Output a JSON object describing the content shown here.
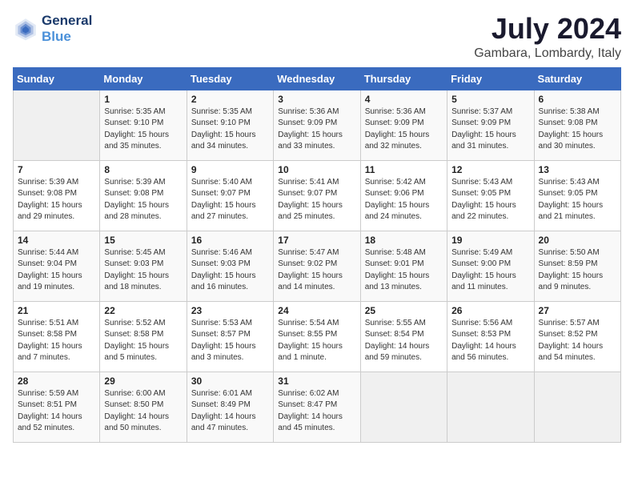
{
  "header": {
    "logo_line1": "General",
    "logo_line2": "Blue",
    "month": "July 2024",
    "location": "Gambara, Lombardy, Italy"
  },
  "weekdays": [
    "Sunday",
    "Monday",
    "Tuesday",
    "Wednesday",
    "Thursday",
    "Friday",
    "Saturday"
  ],
  "weeks": [
    [
      {
        "num": "",
        "info": ""
      },
      {
        "num": "1",
        "info": "Sunrise: 5:35 AM\nSunset: 9:10 PM\nDaylight: 15 hours\nand 35 minutes."
      },
      {
        "num": "2",
        "info": "Sunrise: 5:35 AM\nSunset: 9:10 PM\nDaylight: 15 hours\nand 34 minutes."
      },
      {
        "num": "3",
        "info": "Sunrise: 5:36 AM\nSunset: 9:09 PM\nDaylight: 15 hours\nand 33 minutes."
      },
      {
        "num": "4",
        "info": "Sunrise: 5:36 AM\nSunset: 9:09 PM\nDaylight: 15 hours\nand 32 minutes."
      },
      {
        "num": "5",
        "info": "Sunrise: 5:37 AM\nSunset: 9:09 PM\nDaylight: 15 hours\nand 31 minutes."
      },
      {
        "num": "6",
        "info": "Sunrise: 5:38 AM\nSunset: 9:08 PM\nDaylight: 15 hours\nand 30 minutes."
      }
    ],
    [
      {
        "num": "7",
        "info": "Sunrise: 5:39 AM\nSunset: 9:08 PM\nDaylight: 15 hours\nand 29 minutes."
      },
      {
        "num": "8",
        "info": "Sunrise: 5:39 AM\nSunset: 9:08 PM\nDaylight: 15 hours\nand 28 minutes."
      },
      {
        "num": "9",
        "info": "Sunrise: 5:40 AM\nSunset: 9:07 PM\nDaylight: 15 hours\nand 27 minutes."
      },
      {
        "num": "10",
        "info": "Sunrise: 5:41 AM\nSunset: 9:07 PM\nDaylight: 15 hours\nand 25 minutes."
      },
      {
        "num": "11",
        "info": "Sunrise: 5:42 AM\nSunset: 9:06 PM\nDaylight: 15 hours\nand 24 minutes."
      },
      {
        "num": "12",
        "info": "Sunrise: 5:43 AM\nSunset: 9:05 PM\nDaylight: 15 hours\nand 22 minutes."
      },
      {
        "num": "13",
        "info": "Sunrise: 5:43 AM\nSunset: 9:05 PM\nDaylight: 15 hours\nand 21 minutes."
      }
    ],
    [
      {
        "num": "14",
        "info": "Sunrise: 5:44 AM\nSunset: 9:04 PM\nDaylight: 15 hours\nand 19 minutes."
      },
      {
        "num": "15",
        "info": "Sunrise: 5:45 AM\nSunset: 9:03 PM\nDaylight: 15 hours\nand 18 minutes."
      },
      {
        "num": "16",
        "info": "Sunrise: 5:46 AM\nSunset: 9:03 PM\nDaylight: 15 hours\nand 16 minutes."
      },
      {
        "num": "17",
        "info": "Sunrise: 5:47 AM\nSunset: 9:02 PM\nDaylight: 15 hours\nand 14 minutes."
      },
      {
        "num": "18",
        "info": "Sunrise: 5:48 AM\nSunset: 9:01 PM\nDaylight: 15 hours\nand 13 minutes."
      },
      {
        "num": "19",
        "info": "Sunrise: 5:49 AM\nSunset: 9:00 PM\nDaylight: 15 hours\nand 11 minutes."
      },
      {
        "num": "20",
        "info": "Sunrise: 5:50 AM\nSunset: 8:59 PM\nDaylight: 15 hours\nand 9 minutes."
      }
    ],
    [
      {
        "num": "21",
        "info": "Sunrise: 5:51 AM\nSunset: 8:58 PM\nDaylight: 15 hours\nand 7 minutes."
      },
      {
        "num": "22",
        "info": "Sunrise: 5:52 AM\nSunset: 8:58 PM\nDaylight: 15 hours\nand 5 minutes."
      },
      {
        "num": "23",
        "info": "Sunrise: 5:53 AM\nSunset: 8:57 PM\nDaylight: 15 hours\nand 3 minutes."
      },
      {
        "num": "24",
        "info": "Sunrise: 5:54 AM\nSunset: 8:55 PM\nDaylight: 15 hours\nand 1 minute."
      },
      {
        "num": "25",
        "info": "Sunrise: 5:55 AM\nSunset: 8:54 PM\nDaylight: 14 hours\nand 59 minutes."
      },
      {
        "num": "26",
        "info": "Sunrise: 5:56 AM\nSunset: 8:53 PM\nDaylight: 14 hours\nand 56 minutes."
      },
      {
        "num": "27",
        "info": "Sunrise: 5:57 AM\nSunset: 8:52 PM\nDaylight: 14 hours\nand 54 minutes."
      }
    ],
    [
      {
        "num": "28",
        "info": "Sunrise: 5:59 AM\nSunset: 8:51 PM\nDaylight: 14 hours\nand 52 minutes."
      },
      {
        "num": "29",
        "info": "Sunrise: 6:00 AM\nSunset: 8:50 PM\nDaylight: 14 hours\nand 50 minutes."
      },
      {
        "num": "30",
        "info": "Sunrise: 6:01 AM\nSunset: 8:49 PM\nDaylight: 14 hours\nand 47 minutes."
      },
      {
        "num": "31",
        "info": "Sunrise: 6:02 AM\nSunset: 8:47 PM\nDaylight: 14 hours\nand 45 minutes."
      },
      {
        "num": "",
        "info": ""
      },
      {
        "num": "",
        "info": ""
      },
      {
        "num": "",
        "info": ""
      }
    ]
  ]
}
